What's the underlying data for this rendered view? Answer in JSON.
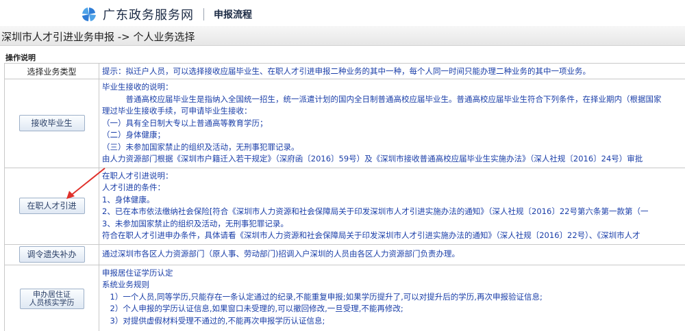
{
  "header": {
    "site_name": "广东政务服务网",
    "subtitle": "申报流程"
  },
  "title_bar": {
    "text": "深圳市人才引进业务申报 -> 个人业务选择"
  },
  "section_label": "操作说明",
  "table": {
    "header_left": "选择业务类型",
    "header_hint": "提示：拟迁户人员，可以选择接收应届毕业生、在职人才引进申报二种业务的其中一种，每个人同一时间只能办理二种业务的其中一项业务。",
    "rows": [
      {
        "button": "接收毕业生",
        "lines": [
          "毕业生接收的说明：",
          "　　　普通高校应届毕业生是指纳入全国统一招生，统一派遣计划的国内全日制普通高校应届毕业生。普通高校应届毕业生符合下列条件，在择业期内（根据国家",
          "理过毕业生接收手续，可申请毕业生接收：",
          "（一）具有全日制大专以上普通高等教育学历；",
          "（二）身体健康；",
          "（三）未参加国家禁止的组织及活动，无刑事犯罪记录。",
          "由人力资源部门根据《深圳市户籍迁入若干规定》（深府函〔2016〕59号）及《深圳市接收普通高校应届毕业生实施办法》（深人社规〔2016〕24号）审批"
        ]
      },
      {
        "button": "在职人才引进",
        "lines": [
          "在职人才引进说明：",
          "人才引进的条件：",
          "1、身体健康。",
          "2、已在本市依法缴纳社会保险[符合《深圳市人力资源和社会保障局关于印发深圳市人才引进实施办法的通知》（深人社规〔2016〕22号第六条第一款第（一",
          "3、未参加国家禁止的组织及活动，无刑事犯罪记录。",
          "符合在职人才引进申办条件，具体请看《深圳市人力资源和社会保障局关于印发深圳市人才引进实施办法的通知》（深人社规〔2016〕22号）、《深圳市人才"
        ]
      },
      {
        "button": "调令遗失补办",
        "lines": [
          "通过深圳市各区人力资源部门（原人事、劳动部门)招调入户深圳的人员由各区人力资源部门负责办理。"
        ]
      },
      {
        "button_line1": "申办居住证",
        "button_line2": "人员核实学历",
        "lines": [
          "申报居住证学历认定",
          "系统业务规则",
          "　1）一个人员,同等学历,只能存在一条认定通过的纪录,不能重复申报;如果学历提升了,可以对提升后的学历,再次申报验证信息;",
          "　2）个人申报的学历认证信息,如果窗口未受理的,可以撤回修改,一旦受理,不能再修改;",
          "　3）对提供虚假材料受理不通过的,不能再次申报学历认证信息;"
        ]
      }
    ]
  },
  "colors": {
    "note_text": "#1a3ea8",
    "arrow": "#e0312b",
    "logo": "#2e7cd6"
  }
}
